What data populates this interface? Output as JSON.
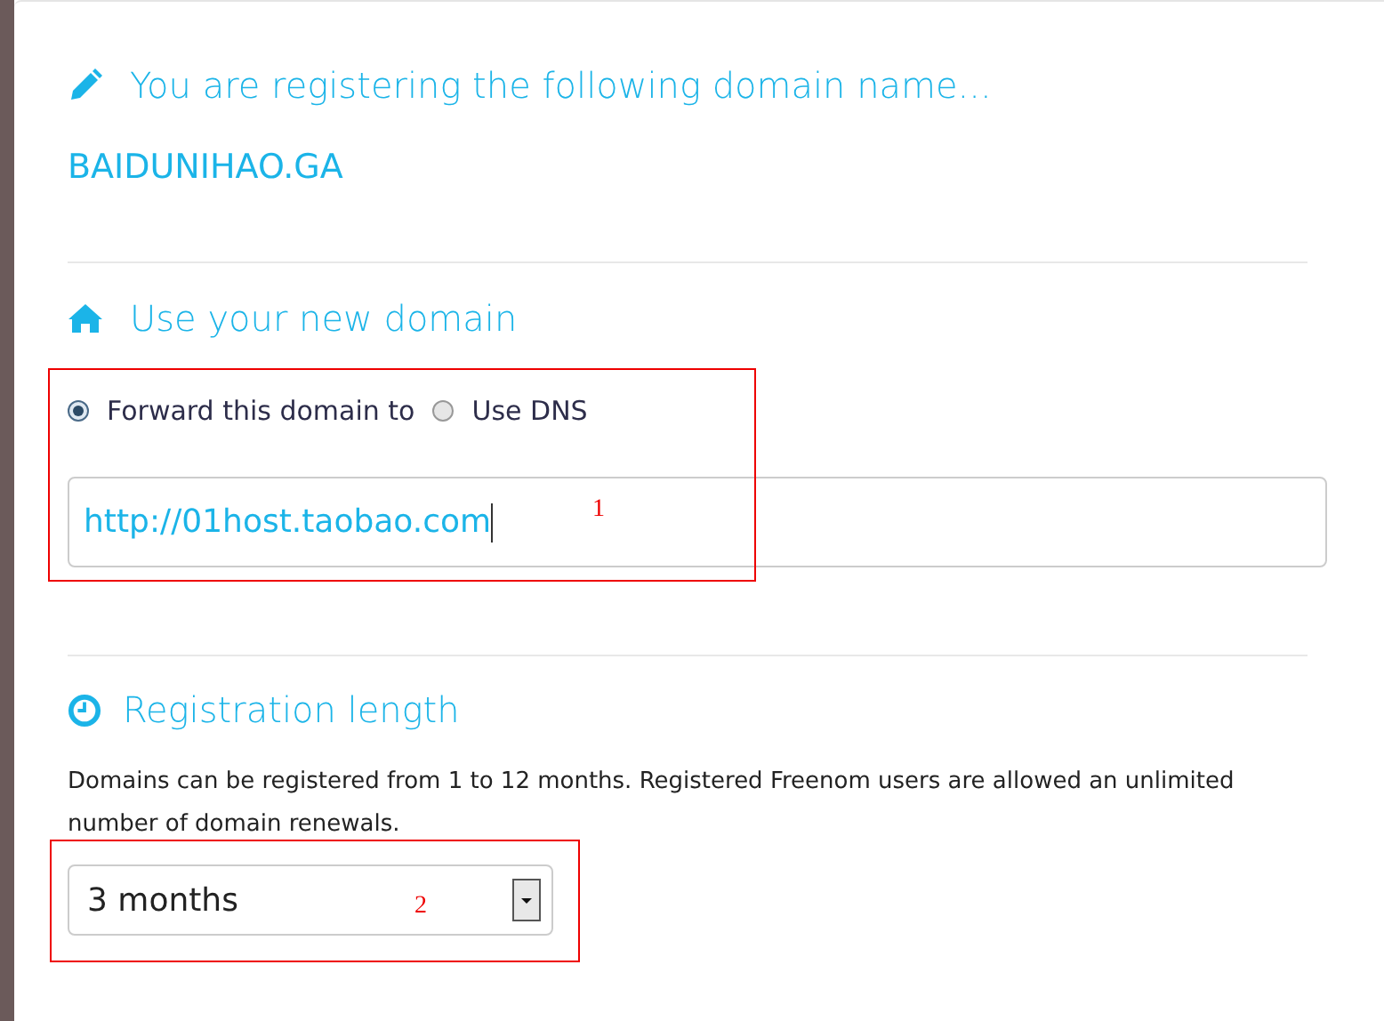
{
  "heading": {
    "title": "You are registering the following domain name...",
    "domain": "BAIDUNIHAO.GA"
  },
  "use_domain": {
    "title": "Use your new domain",
    "options": [
      {
        "label": "Forward this domain to",
        "selected": true
      },
      {
        "label": "Use DNS",
        "selected": false
      }
    ],
    "url_field": {
      "value": "http://01host.taobao.com"
    }
  },
  "registration": {
    "title": "Registration length",
    "description": "Domains can be registered from 1 to 12 months. Registered Freenom users are allowed an unlimited number of domain renewals.",
    "period_select": {
      "value": "3 months"
    }
  },
  "annotations": [
    {
      "label": "1"
    },
    {
      "label": "2"
    }
  ]
}
